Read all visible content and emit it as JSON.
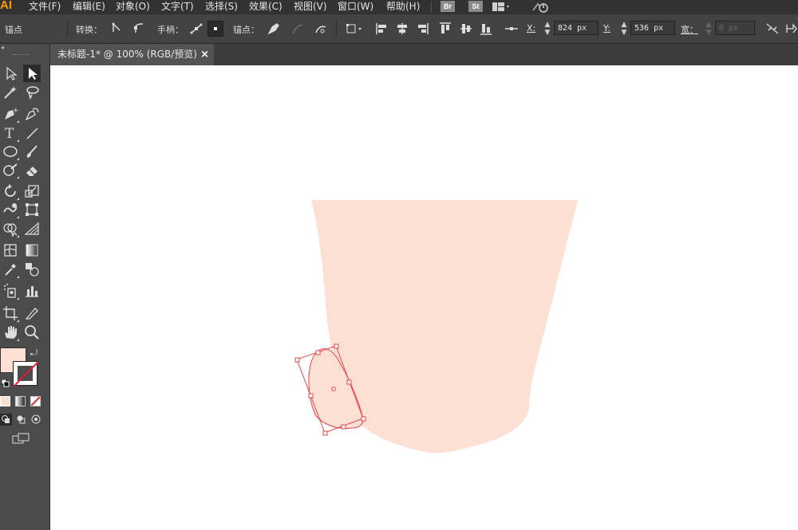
{
  "app": {
    "logo": "AI"
  },
  "menu": [
    "文件(F)",
    "编辑(E)",
    "对象(O)",
    "文字(T)",
    "选择(S)",
    "效果(C)",
    "视图(V)",
    "窗口(W)",
    "帮助(H)"
  ],
  "bridge_badges": [
    "Br",
    "St"
  ],
  "control_bar": {
    "selection_type": "锚点",
    "convert_label": "转换：",
    "handles_label": "手柄：",
    "anchors_label": "锚点：",
    "x_label": "X:",
    "x_value": "824 px",
    "y_label": "Y:",
    "y_value": "536 px",
    "width_label": "宽：",
    "width_value": "0 px"
  },
  "document_tab": {
    "title": "未标题-1* @ 100% (RGB/预览)",
    "close": "×"
  },
  "colors": {
    "fill": "#fde0d4",
    "stroke": "#e0454a",
    "canvas": "#ffffff",
    "shape": "#fde0d4"
  },
  "icons": {
    "selection": "arrow-icon",
    "direct_selection": "direct-select-icon",
    "magic_wand": "magic-wand-icon",
    "lasso": "lasso-icon",
    "pen": "pen-icon",
    "curvature": "curvature-icon",
    "type": "type-icon",
    "line": "line-icon",
    "ellipse": "ellipse-icon",
    "paintbrush": "paintbrush-icon",
    "blob_brush": "blob-brush-icon",
    "eraser": "eraser-icon",
    "rotate": "rotate-icon",
    "scale": "scale-icon",
    "warp": "warp-icon",
    "free_transform": "free-transform-icon",
    "shape_builder": "shape-builder-icon",
    "perspective": "perspective-icon",
    "mesh": "mesh-icon",
    "gradient": "gradient-icon",
    "eyedropper": "eyedropper-icon",
    "blend": "blend-icon",
    "symbol_sprayer": "symbol-sprayer-icon",
    "graph": "graph-icon",
    "artboard": "artboard-icon",
    "slice": "slice-icon",
    "hand": "hand-icon",
    "zoom": "zoom-icon"
  }
}
